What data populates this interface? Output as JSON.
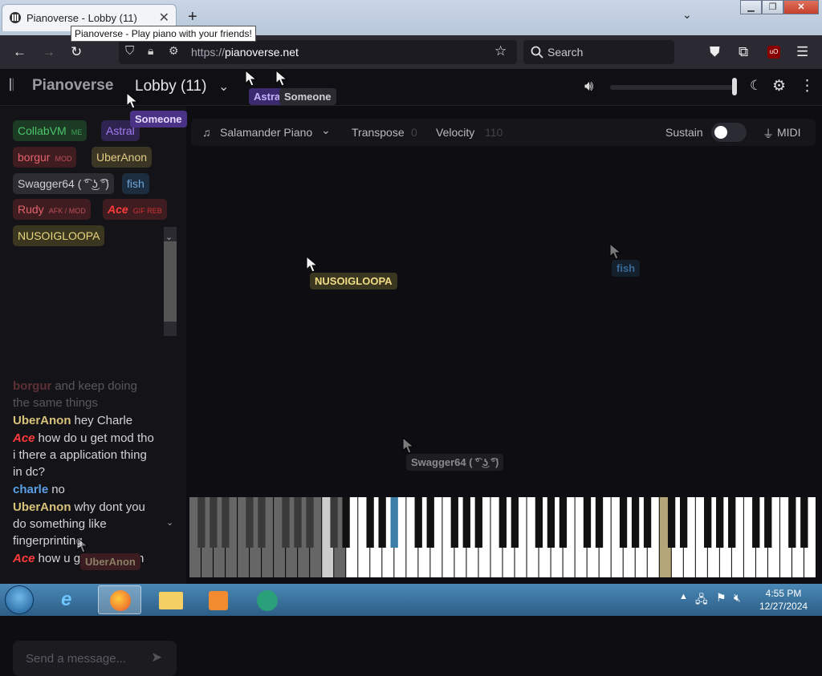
{
  "browser": {
    "tab_title": "Pianoverse - Lobby (11)",
    "tooltip": "Pianoverse - Play piano with your friends!",
    "url_prefix": "https://",
    "url_domain": "pianoverse.net",
    "search_placeholder": "Search",
    "new_tab": "+",
    "close_tab": "✕"
  },
  "app": {
    "logo_text": "Pianoverse",
    "lobby_label": "Lobby (11)",
    "volume_level": 0.98
  },
  "users": [
    {
      "name": "CollabVM",
      "tag": "ME",
      "color": "#4cc46b",
      "bg": "#1c3b24"
    },
    {
      "name": "Astral",
      "tag": "",
      "color": "#9f7cf0",
      "bg": "#2f2450"
    },
    {
      "name": "borgur",
      "tag": "MOD",
      "color": "#e3626b",
      "bg": "#3f1c20"
    },
    {
      "name": "UberAnon",
      "tag": "",
      "color": "#e2cc86",
      "bg": "#3b3623"
    },
    {
      "name": "Swagger64 ( ͡° ͜ʖ ͡°)",
      "tag": "",
      "color": "#cfcfd3",
      "bg": "#2c2c32"
    },
    {
      "name": "fish",
      "tag": "",
      "color": "#6fa8d8",
      "bg": "#1c2d40"
    },
    {
      "name": "Rudy",
      "tag": "AFK / MOD",
      "color": "#e3626b",
      "bg": "#3f1c20"
    },
    {
      "name": "Ace",
      "tag": "GIF REB",
      "color": "#ff3b3b",
      "bg": "#3f1c20"
    },
    {
      "name": "NUSOIGLOOPA",
      "tag": "",
      "color": "#e8d57a",
      "bg": "#3b3620"
    }
  ],
  "chat": [
    {
      "user": "borgur",
      "text": "and keep doing the same things",
      "color": "#e3626b"
    },
    {
      "user": "UberAnon",
      "text": "hey Charle",
      "color": "#d8c27a"
    },
    {
      "user": "Ace",
      "text": "how do u get mod tho i there a application thing in dc?",
      "color": "#ff3b3b"
    },
    {
      "user": "charle",
      "text": "no",
      "color": "#5aa0e8"
    },
    {
      "user": "UberAnon",
      "text": "why dont you do something like fingerprinting",
      "color": "#d8c27a"
    },
    {
      "user": "Ace",
      "text": "how u get mod then",
      "color": "#ff3b3b"
    }
  ],
  "chat_input_placeholder": "Send a message...",
  "toolbar": {
    "instrument": "Salamander Piano",
    "transpose_label": "Transpose",
    "transpose_value": "0",
    "velocity_label": "Velocity",
    "velocity_value": "110",
    "sustain_label": "Sustain",
    "midi_label": "MIDI"
  },
  "cursors": [
    {
      "name": "Astral",
      "color": "#c7b2ff",
      "bg": "#3b2a6e"
    },
    {
      "name": "Someone",
      "color": "#cfcfd3",
      "bg": "#2a2a30"
    },
    {
      "name": "Someone",
      "color": "#e6dcff",
      "bg": "#4a3286"
    },
    {
      "name": "NUSOIGLOOPA",
      "color": "#f0dc85",
      "bg": "#3b3620"
    },
    {
      "name": "fish",
      "color": "#3a6a96",
      "bg": "#14202c"
    },
    {
      "name": "Swagger64 ( ͡° ͜ʖ ͡°)",
      "color": "#8a8a8e",
      "bg": "#1e1e22"
    },
    {
      "name": "UberAnon",
      "color": "#8a7f66",
      "bg": "#3b1c20"
    }
  ],
  "taskbar": {
    "time": "4:55 PM",
    "date": "12/27/2024"
  }
}
